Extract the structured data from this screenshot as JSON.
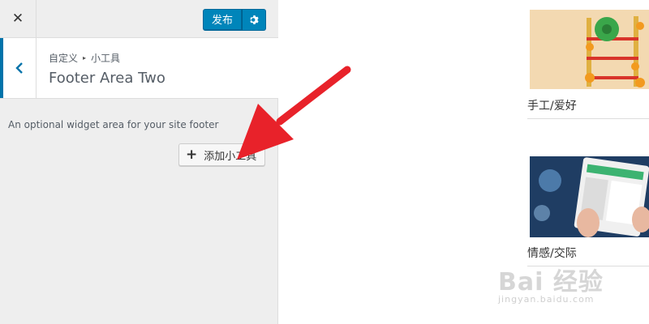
{
  "topbar": {
    "close_glyph": "✕",
    "publish_label": "发布",
    "settings_icon": "gear-icon"
  },
  "section": {
    "breadcrumb_root": "自定义",
    "breadcrumb_sep": "▸",
    "breadcrumb_current": "小工具",
    "title": "Footer Area Two",
    "description": "An optional widget area for your site footer",
    "add_widget_label": "添加小工具"
  },
  "preview": {
    "cards": [
      {
        "caption": "手工/爱好"
      },
      {
        "caption": "情感/交际"
      }
    ],
    "watermark_main": "Bai 经验",
    "watermark_sub": "jingyan.baidu.com"
  },
  "colors": {
    "accent": "#0085ba",
    "annotation_arrow": "#e8222a"
  }
}
